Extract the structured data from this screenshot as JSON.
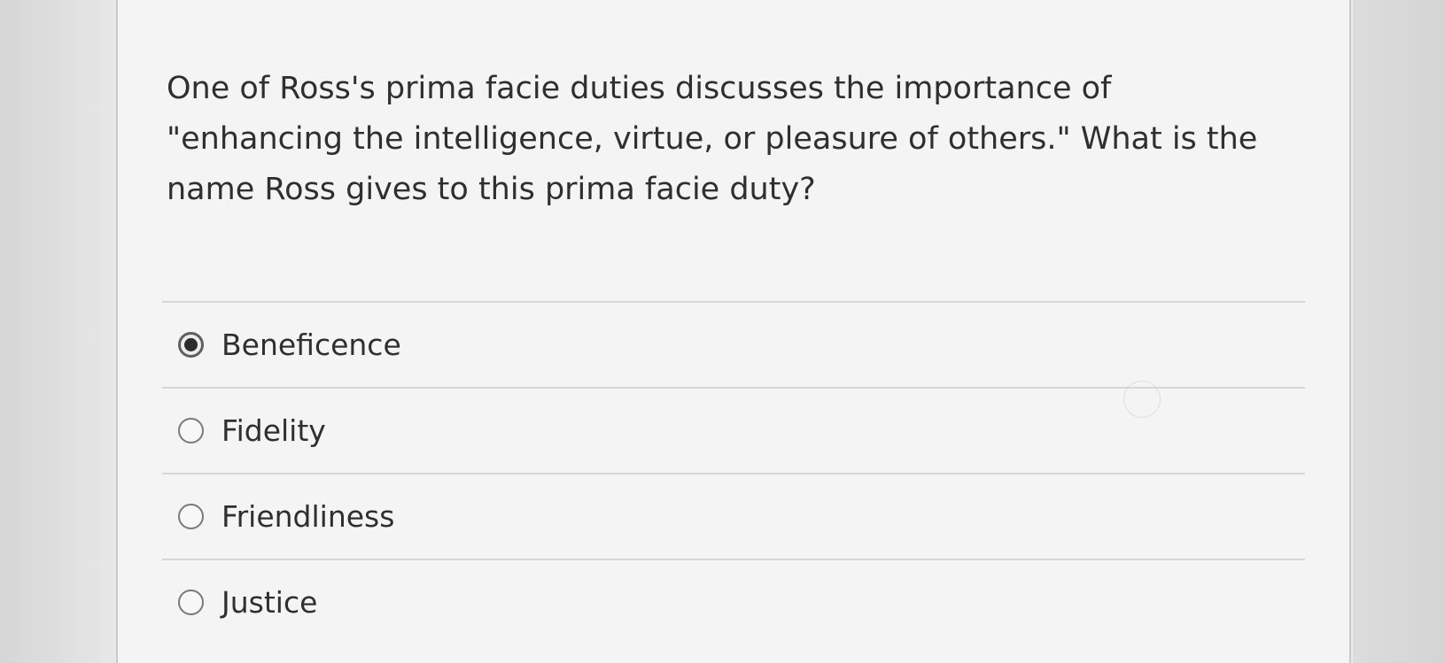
{
  "question": {
    "text": "One of Ross's prima facie duties discusses the importance of \"enhancing the intelligence, virtue, or pleasure of others.\" What is the name Ross gives to this prima facie duty?"
  },
  "options": [
    {
      "label": "Beneficence",
      "selected": true
    },
    {
      "label": "Fidelity",
      "selected": false
    },
    {
      "label": "Friendliness",
      "selected": false
    },
    {
      "label": "Justice",
      "selected": false
    }
  ],
  "colors": {
    "text": "#2f2f2f",
    "radio_border": "#7a7a7a",
    "radio_dot": "#2c2c2c",
    "divider": "#d6d6d6"
  }
}
